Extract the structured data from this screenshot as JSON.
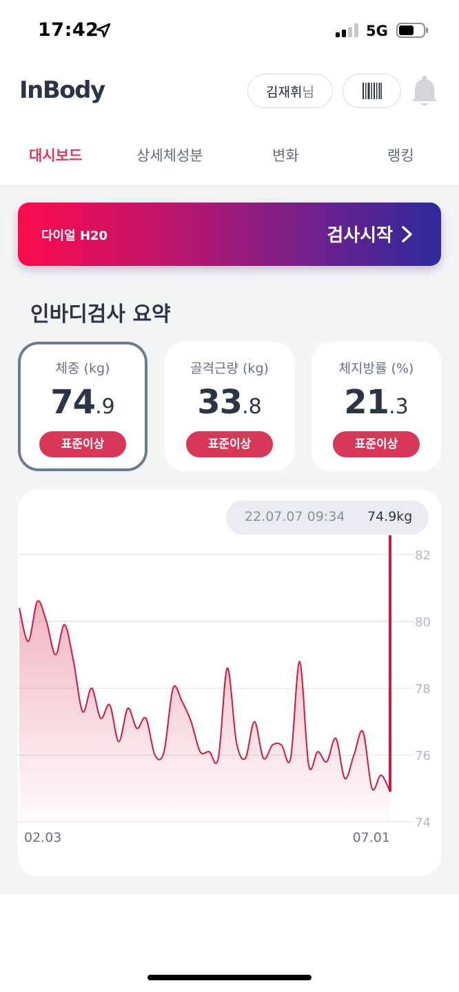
{
  "status_bar": {
    "time": "17:42",
    "network": "5G"
  },
  "header": {
    "logo": "InBody",
    "user_name": "김재휘",
    "user_suffix": "님"
  },
  "tabs": [
    {
      "label": "대시보드",
      "active": true
    },
    {
      "label": "상세체성분",
      "active": false
    },
    {
      "label": "변화",
      "active": false
    },
    {
      "label": "랭킹",
      "active": false
    }
  ],
  "banner": {
    "device": "다이얼 H20",
    "action": "검사시작"
  },
  "summary": {
    "title": "인바디검사 요약",
    "metrics": [
      {
        "label": "체중 (kg)",
        "int": "74",
        "dec": ".9",
        "badge": "표준이상",
        "selected": true
      },
      {
        "label": "골격근량 (kg)",
        "int": "33",
        "dec": ".8",
        "badge": "표준이상",
        "selected": false
      },
      {
        "label": "체지방률 (%)",
        "int": "21",
        "dec": ".3",
        "badge": "표준이상",
        "selected": false
      }
    ]
  },
  "chart": {
    "tooltip_date": "22.07.07 09:34",
    "tooltip_value": "74.9kg",
    "colors": {
      "line": "#d3173f",
      "grid": "#e6e7ea",
      "axis_text": "#b4b8c0"
    }
  },
  "chart_data": {
    "type": "area",
    "title": "",
    "xlabel": "",
    "ylabel": "",
    "x_tick_labels": [
      "02.03",
      "07.01"
    ],
    "y_ticks": [
      "82",
      "80",
      "78",
      "76",
      "74"
    ],
    "ylim": [
      74,
      82.5
    ],
    "grid": true,
    "series": [
      {
        "values": [
          80.4,
          79.4,
          80.6,
          80.0,
          79.0,
          79.9,
          78.8,
          77.3,
          78.0,
          77.1,
          77.5,
          76.4,
          77.4,
          76.8,
          77.1,
          76.0,
          76.1,
          78.0,
          77.6,
          77.0,
          76.1,
          76.1,
          75.9,
          78.6,
          76.4,
          75.9,
          77.0,
          75.9,
          76.3,
          76.3,
          75.9,
          78.8,
          75.7,
          76.1,
          75.8,
          76.5,
          75.3,
          76.0,
          76.7,
          75.0,
          75.4,
          74.9
        ]
      }
    ]
  }
}
